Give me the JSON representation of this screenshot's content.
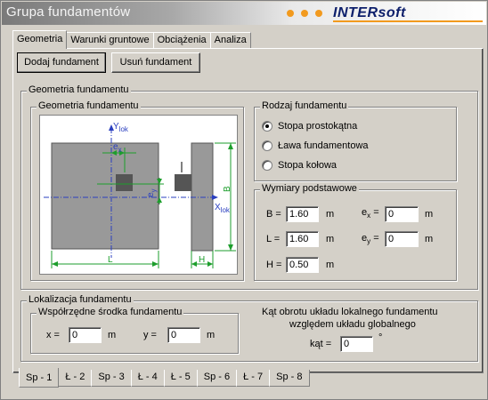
{
  "window": {
    "title": "Grupa fundamentów"
  },
  "brand": {
    "name": "INTERsoft",
    "dot_color": "#f29a1e",
    "text_color": "#0d1f6b"
  },
  "tabs": [
    {
      "label": "Geometria",
      "active": true
    },
    {
      "label": "Warunki gruntowe",
      "active": false
    },
    {
      "label": "Obciążenia",
      "active": false
    },
    {
      "label": "Analiza",
      "active": false
    }
  ],
  "toolbar": {
    "add_label": "Dodaj fundament",
    "remove_label": "Usuń fundament"
  },
  "geometry_group": {
    "title": "Geometria fundamentu"
  },
  "diagram": {
    "title": "Geometria fundamentu",
    "labels": {
      "ylok_base": "Y",
      "ylok_sub": "lok",
      "xlok_base": "X",
      "xlok_sub": "lok",
      "ex_base": "e",
      "ex_sub": "x",
      "ey_base": "e",
      "ey_sub": "y",
      "B": "B",
      "L": "L",
      "H": "H"
    },
    "color_axis": "#2a3fbf",
    "color_dim": "#1d9e2c"
  },
  "type_group": {
    "title": "Rodzaj fundamentu",
    "options": [
      {
        "label": "Stopa prostokątna",
        "checked": true
      },
      {
        "label": "Ława fundamentowa",
        "checked": false
      },
      {
        "label": "Stopa kołowa",
        "checked": false
      }
    ]
  },
  "dims_group": {
    "title": "Wymiary podstawowe",
    "B": {
      "label": "B =",
      "value": "1.60",
      "unit": "m"
    },
    "L": {
      "label": "L =",
      "value": "1.60",
      "unit": "m"
    },
    "H": {
      "label": "H =",
      "value": "0.50",
      "unit": "m"
    },
    "ex": {
      "label_base": "e",
      "label_sub": "x",
      "label_eq": "=",
      "value": "0",
      "unit": "m"
    },
    "ey": {
      "label_base": "e",
      "label_sub": "y",
      "label_eq": "=",
      "value": "0",
      "unit": "m"
    }
  },
  "location_group": {
    "title": "Lokalizacja fundamentu",
    "center_title": "Współrzędne środka fundamentu",
    "x": {
      "label": "x =",
      "value": "0",
      "unit": "m"
    },
    "y": {
      "label": "y =",
      "value": "0",
      "unit": "m"
    },
    "rotation_line1": "Kąt obrotu układu lokalnego  fundamentu",
    "rotation_line2": "względem układu globalnego",
    "angle": {
      "label": "kąt =",
      "value": "0",
      "unit": "°"
    }
  },
  "bottom_tabs": [
    {
      "label": "Sp - 1",
      "active": true
    },
    {
      "label": "Ł - 2",
      "active": false
    },
    {
      "label": "Sp - 3",
      "active": false
    },
    {
      "label": "Ł - 4",
      "active": false
    },
    {
      "label": "Ł - 5",
      "active": false
    },
    {
      "label": "Sp - 6",
      "active": false
    },
    {
      "label": "Ł - 7",
      "active": false
    },
    {
      "label": "Sp - 8",
      "active": false
    }
  ]
}
